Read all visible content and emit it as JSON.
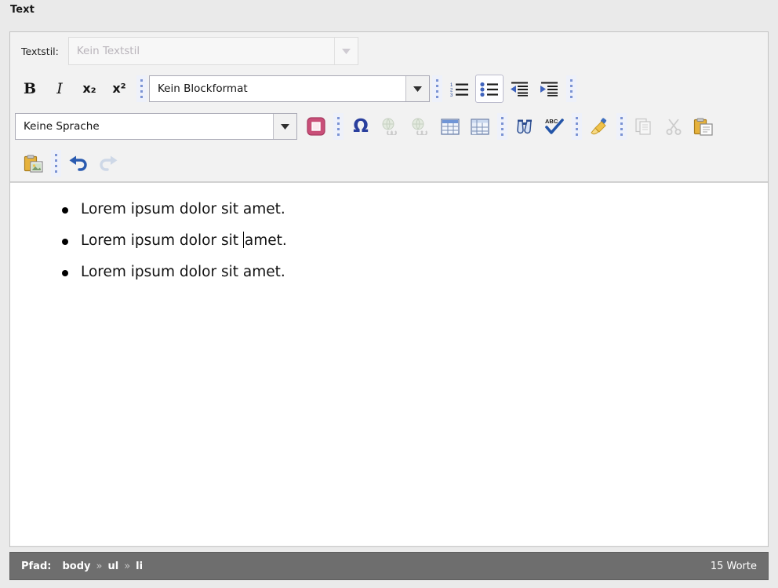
{
  "page": {
    "title": "Text"
  },
  "editor": {
    "style_label": "Textstil:",
    "style_select": {
      "value": "Kein Textstil",
      "disabled": true,
      "name": "textstil-select"
    },
    "block_select": {
      "value": "Kein Blockformat",
      "name": "blockformat-select"
    },
    "language_select": {
      "value": "Keine Sprache",
      "name": "sprache-select"
    },
    "toolbar_row2": [
      {
        "name": "bold-button",
        "label": "B",
        "icon": "bold-icon",
        "state": "normal"
      },
      {
        "name": "italic-button",
        "label": "I",
        "icon": "italic-icon",
        "state": "normal"
      },
      {
        "name": "subscript-button",
        "label": "x₂",
        "icon": "subscript-icon",
        "state": "normal"
      },
      {
        "name": "superscript-button",
        "label": "x²",
        "icon": "superscript-icon",
        "state": "normal"
      }
    ],
    "toolbar_lists": [
      {
        "name": "numbered-list-button",
        "icon": "numbered-list-icon",
        "state": "normal"
      },
      {
        "name": "bullet-list-button",
        "icon": "bullet-list-icon",
        "state": "active"
      },
      {
        "name": "outdent-button",
        "icon": "outdent-icon",
        "state": "normal"
      },
      {
        "name": "indent-button",
        "icon": "indent-icon",
        "state": "normal"
      }
    ],
    "toolbar_row3": [
      {
        "name": "anchor-button",
        "icon": "anchor-icon",
        "state": "normal"
      },
      {
        "name": "special-char-button",
        "icon": "omega-icon",
        "state": "normal"
      },
      {
        "name": "insert-link-button",
        "icon": "globe-link-icon",
        "state": "disabled"
      },
      {
        "name": "unlink-button",
        "icon": "globe-unlink-icon",
        "state": "disabled"
      },
      {
        "name": "insert-table-button",
        "icon": "table-icon",
        "state": "normal"
      },
      {
        "name": "table-props-button",
        "icon": "table-header-icon",
        "state": "normal"
      },
      {
        "name": "find-replace-button",
        "icon": "binoculars-icon",
        "state": "normal"
      },
      {
        "name": "spellcheck-button",
        "icon": "spellcheck-icon",
        "state": "normal"
      },
      {
        "name": "remove-format-button",
        "icon": "broom-icon",
        "state": "normal"
      },
      {
        "name": "copy-button",
        "icon": "copy-icon",
        "state": "disabled"
      },
      {
        "name": "cut-button",
        "icon": "scissors-icon",
        "state": "disabled"
      },
      {
        "name": "paste-button",
        "icon": "paste-icon",
        "state": "normal"
      }
    ],
    "toolbar_row4": [
      {
        "name": "paste-image-button",
        "icon": "paste-image-icon",
        "state": "normal"
      },
      {
        "name": "undo-button",
        "icon": "undo-icon",
        "state": "normal"
      },
      {
        "name": "redo-button",
        "icon": "redo-icon",
        "state": "disabled"
      }
    ],
    "content": {
      "list_items": [
        {
          "text": "Lorem ipsum dolor sit amet."
        },
        {
          "before": "Lorem ipsum dolor sit ",
          "after": "amet.",
          "caret": true
        },
        {
          "text": "Lorem ipsum dolor sit amet."
        }
      ]
    },
    "statusbar": {
      "path_label": "Pfad:",
      "path_crumbs": [
        "body",
        "ul",
        "li"
      ],
      "path_separator": "»",
      "word_count": "15 Worte"
    }
  },
  "colors": {
    "page_bg": "#eaeaea",
    "frame_bg": "#f2f2f2",
    "content_bg": "#ffffff",
    "statusbar_bg": "#6e6e6e",
    "anchor_pink": "#c94f78",
    "omega_blue": "#2a3f9d",
    "separator_dot": "#7b93d4"
  }
}
